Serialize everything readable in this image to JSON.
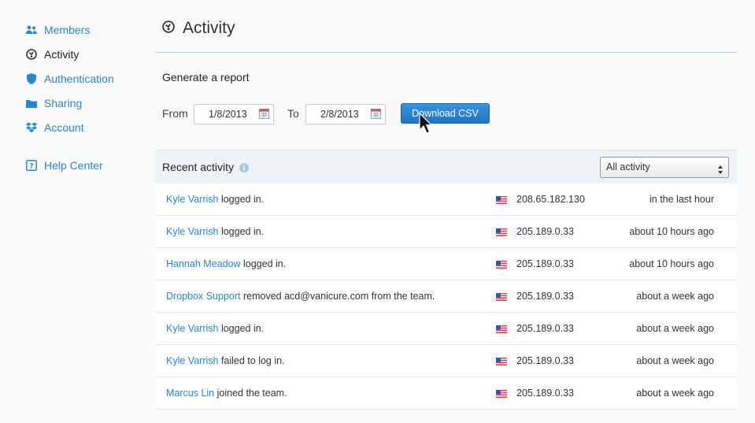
{
  "sidebar": {
    "items": [
      {
        "label": "Members",
        "icon": "members-icon",
        "active": false
      },
      {
        "label": "Activity",
        "icon": "activity-icon",
        "active": true
      },
      {
        "label": "Authentication",
        "icon": "shield-icon",
        "active": false
      },
      {
        "label": "Sharing",
        "icon": "folder-icon",
        "active": false
      },
      {
        "label": "Account",
        "icon": "dropbox-icon",
        "active": false
      }
    ],
    "help": {
      "label": "Help Center",
      "icon": "help-icon"
    }
  },
  "page": {
    "title": "Activity"
  },
  "report": {
    "heading": "Generate a report",
    "from_label": "From",
    "from_value": "1/8/2013",
    "to_label": "To",
    "to_value": "2/8/2013",
    "download_label": "Download CSV"
  },
  "recent": {
    "title": "Recent activity",
    "filter_value": "All activity",
    "rows": [
      {
        "who": "Kyle Varrish",
        "action": " logged in.",
        "ip": "208.65.182.130",
        "when": "in the last hour"
      },
      {
        "who": "Kyle Varrish",
        "action": " logged in.",
        "ip": "205.189.0.33",
        "when": "about 10 hours ago"
      },
      {
        "who": "Hannah Meadow",
        "action": " logged in.",
        "ip": "205.189.0.33",
        "when": "about 10 hours ago"
      },
      {
        "who": "Dropbox Support",
        "action": " removed acd@vanicure.com from the team.",
        "ip": "205.189.0.33",
        "when": "about a week ago"
      },
      {
        "who": "Kyle Varrish",
        "action": " logged in.",
        "ip": "205.189.0.33",
        "when": "about a week ago"
      },
      {
        "who": "Kyle Varrish",
        "action": " failed to log in.",
        "ip": "205.189.0.33",
        "when": "about a week ago"
      },
      {
        "who": "Marcus Lin",
        "action": " joined the team.",
        "ip": "205.189.0.33",
        "when": "about a week ago"
      }
    ]
  },
  "colors": {
    "accent": "#2a86d0",
    "button": "#1f74c4"
  }
}
